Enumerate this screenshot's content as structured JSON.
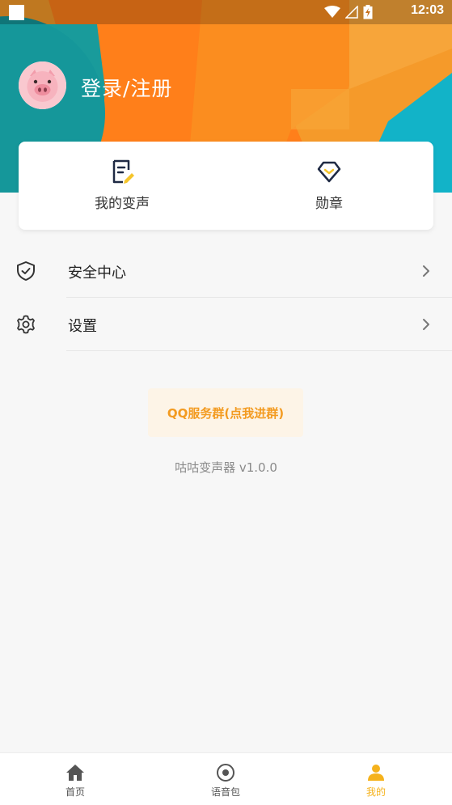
{
  "status_bar": {
    "time": "12:03"
  },
  "header": {
    "login_label": "登录/注册"
  },
  "quick_card": {
    "items": [
      {
        "label": "我的变声",
        "icon": "edit-document-icon"
      },
      {
        "label": "勋章",
        "icon": "badge-diamond-icon"
      }
    ]
  },
  "menu": {
    "items": [
      {
        "label": "安全中心",
        "icon": "shield-check-icon"
      },
      {
        "label": "设置",
        "icon": "gear-icon"
      }
    ]
  },
  "qq_group_button": "QQ服务群(点我进群)",
  "version_text": "咕咕变声器 v1.0.0",
  "tab_bar": {
    "tabs": [
      {
        "label": "首页",
        "icon": "home-icon"
      },
      {
        "label": "语音包",
        "icon": "voice-pack-icon"
      },
      {
        "label": "我的",
        "icon": "user-icon",
        "active": true
      }
    ]
  },
  "colors": {
    "accent": "#f5b21c",
    "qq_text": "#f39b21",
    "hero_orange": "#ff8a1f",
    "hero_teal": "#1fb0c4"
  }
}
